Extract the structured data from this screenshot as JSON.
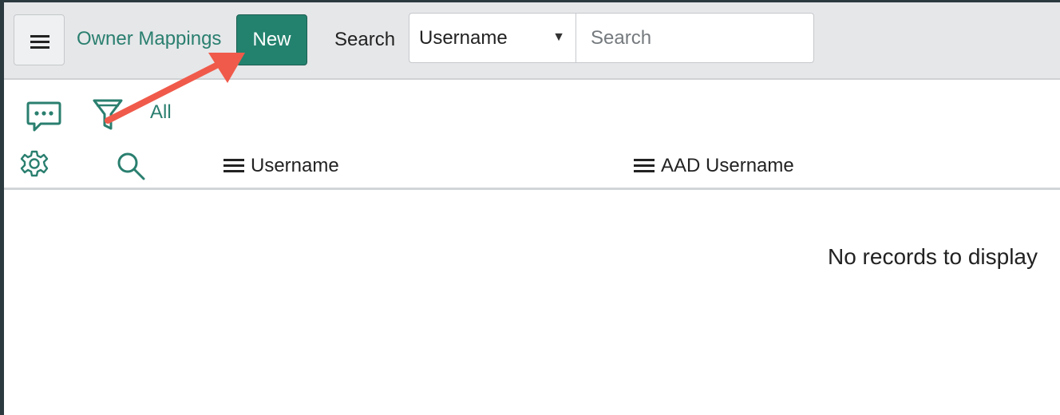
{
  "header": {
    "menu_icon": "hamburger-icon",
    "title": "Owner Mappings",
    "new_label": "New",
    "search_label": "Search",
    "search_field_selected": "Username",
    "search_placeholder": "Search"
  },
  "toolbar": {
    "chat_icon": "chat-bubble-icon",
    "filter_icon": "filter-icon",
    "filter_label": "All"
  },
  "list": {
    "settings_icon": "gear-icon",
    "search_icon": "search-icon",
    "columns": [
      {
        "label": "Username"
      },
      {
        "label": "AAD Username"
      }
    ],
    "empty_message": "No records to display"
  },
  "colors": {
    "accent": "#23826e",
    "link": "#2a7f6f",
    "annotation_arrow": "#f05a4a"
  }
}
